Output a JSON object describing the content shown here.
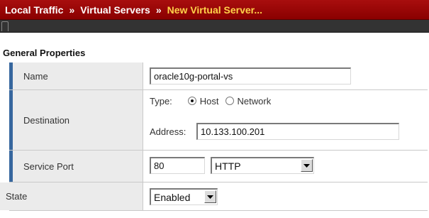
{
  "breadcrumb": {
    "items": [
      "Local Traffic",
      "Virtual Servers"
    ],
    "separator": "»",
    "current": "New Virtual Server..."
  },
  "section": {
    "title": "General Properties"
  },
  "form": {
    "name": {
      "label": "Name",
      "value": "oracle10g-portal-vs"
    },
    "destination": {
      "label": "Destination",
      "type_label": "Type:",
      "type_options": [
        "Host",
        "Network"
      ],
      "type_selected": "Host",
      "address_label": "Address:",
      "address_value": "10.133.100.201"
    },
    "service_port": {
      "label": "Service Port",
      "port_value": "80",
      "protocol_value": "HTTP"
    },
    "state": {
      "label": "State",
      "value": "Enabled"
    }
  },
  "colors": {
    "title_bar": "#9a0000",
    "current_crumb": "#ffd24a",
    "row_accent": "#37679e",
    "label_bg": "#ebebeb"
  }
}
